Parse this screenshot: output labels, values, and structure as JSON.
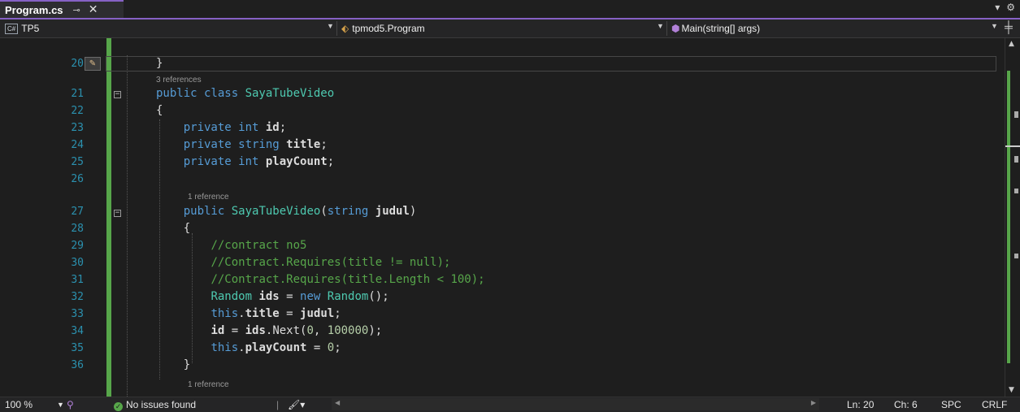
{
  "tab": {
    "title": "Program.cs",
    "pin_icon": "pin-icon",
    "close_label": "✕"
  },
  "navbar": {
    "project": "TP5",
    "project_badge": "C#",
    "type": "tpmod5.Program",
    "member": "Main(string[] args)"
  },
  "editor": {
    "current_line_number": "20",
    "lens_refs_class": "3 references",
    "lens_refs_ctor": "1 reference",
    "lens_refs_next": "1 reference",
    "lines": [
      {
        "n": "21",
        "code": "public class SayaTubeVideo"
      },
      {
        "n": "22",
        "code": "{"
      },
      {
        "n": "23",
        "code": "private int id;"
      },
      {
        "n": "24",
        "code": "private string title;"
      },
      {
        "n": "25",
        "code": "private int playCount;"
      },
      {
        "n": "26",
        "code": ""
      },
      {
        "n": "27",
        "code": "public SayaTubeVideo(string judul)"
      },
      {
        "n": "28",
        "code": "{"
      },
      {
        "n": "29",
        "code": "//contract no5"
      },
      {
        "n": "30",
        "code": "//Contract.Requires(title != null);"
      },
      {
        "n": "31",
        "code": "//Contract.Requires(title.Length < 100);"
      },
      {
        "n": "32",
        "code": "Random ids = new Random();"
      },
      {
        "n": "33",
        "code": "this.title = judul;"
      },
      {
        "n": "34",
        "code": "id = ids.Next(0, 100000);"
      },
      {
        "n": "35",
        "code": "this.playCount = 0;"
      },
      {
        "n": "36",
        "code": "}"
      }
    ]
  },
  "status": {
    "zoom": "100 %",
    "issues": "No issues found",
    "ln": "Ln: 20",
    "ch": "Ch: 6",
    "spc": "SPC",
    "crlf": "CRLF"
  },
  "colors": {
    "accent": "#8661c5",
    "keyword": "#569cd6",
    "type": "#4ec9b0",
    "comment": "#57a64a",
    "number": "#b5cea8",
    "line_number": "#2b91af"
  }
}
